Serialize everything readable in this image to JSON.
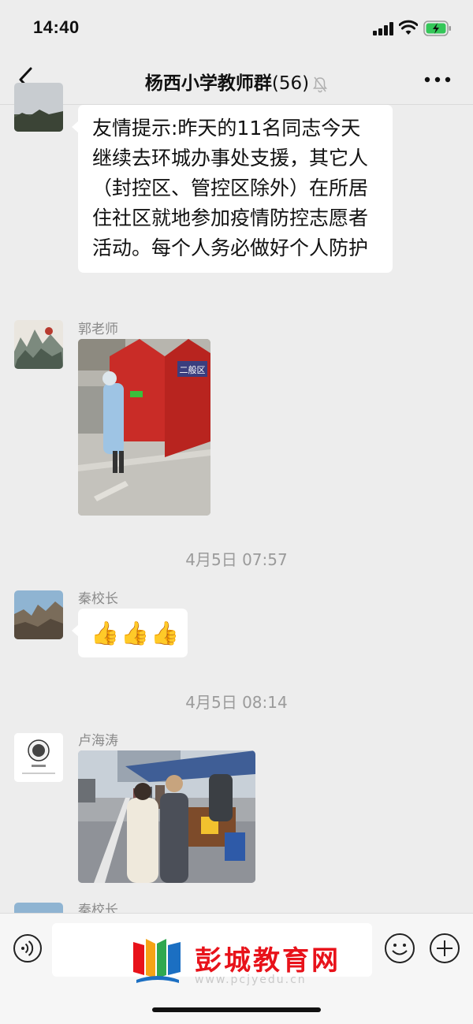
{
  "status_bar": {
    "time": "14:40"
  },
  "header": {
    "title": "杨西小学教师群",
    "member_count": "(56)"
  },
  "messages": [
    {
      "text": "友情提示:昨天的11名同志今天继续去环城办事处支援，其它人（封控区、管控区除外）在所居住社区就地参加疫情防控志愿者活动。每个人务必做好个人防护"
    },
    {
      "sender": "郭老师",
      "image": "photo of a staff member in a protective gown spraying disinfectant beside red tents",
      "tent_sign": "二般区"
    },
    {
      "sender": "秦校长",
      "emoji": "👍👍👍"
    },
    {
      "sender": "卢海涛",
      "image": "photo of a queue of people at a community testing station under a blue canopy"
    },
    {
      "sender": "秦校长"
    }
  ],
  "timestamps": [
    "4月5日 07:57",
    "4月5日 08:14"
  ],
  "watermark": {
    "brand": "彭城教育网",
    "url": "www.pcjyedu.cn"
  },
  "colors": {
    "background": "#ededed",
    "bubble": "#ffffff",
    "brand_red": "#e8121a"
  }
}
